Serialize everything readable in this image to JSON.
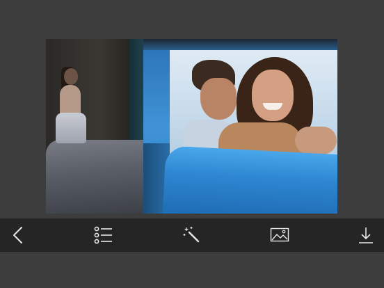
{
  "canvas": {
    "background_scene": "bedroom",
    "frame_style": "window",
    "frame_color": "#3f93d6"
  },
  "toolbar": {
    "background": "#252526",
    "items": [
      {
        "icon": "chevron-left-icon"
      },
      {
        "icon": "list-icon"
      },
      {
        "icon": "magic-wand-icon"
      },
      {
        "icon": "image-icon"
      },
      {
        "icon": "download-icon"
      }
    ]
  }
}
